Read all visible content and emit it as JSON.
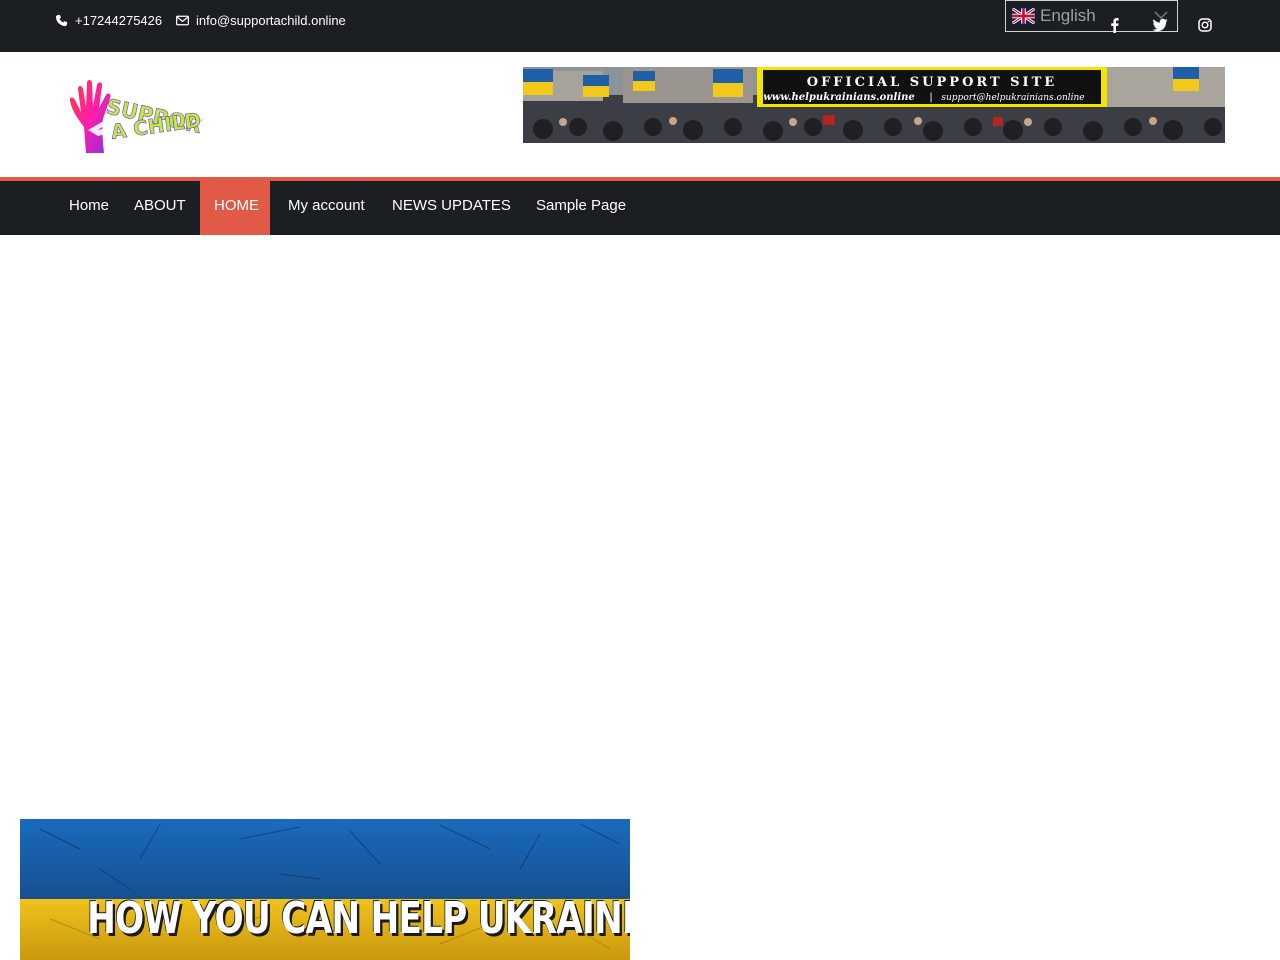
{
  "topbar": {
    "phone": "+17244275426",
    "email": "info@supportachild.online",
    "language": {
      "selected": "English",
      "flag_icon": "uk-flag-icon"
    },
    "social": [
      "facebook-icon",
      "twitter-icon",
      "instagram-icon"
    ]
  },
  "logo": {
    "line1": "SUPPORT",
    "line2": "A CHILD"
  },
  "banner": {
    "title": "OFFICIAL SUPPORT SITE",
    "website": "www.helpukrainians.online",
    "separator": "|",
    "email": "support@helpukrainians.online"
  },
  "nav": {
    "items": [
      {
        "label": "Home",
        "active": false
      },
      {
        "label": "ABOUT",
        "active": false
      },
      {
        "label": "HOME",
        "active": true
      },
      {
        "label": "My account",
        "active": false
      },
      {
        "label": "NEWS UPDATES",
        "active": false
      },
      {
        "label": "Sample Page",
        "active": false
      }
    ]
  },
  "promo": {
    "headline": "HOW YOU CAN HELP UKRAINE"
  },
  "colors": {
    "topbar_bg": "#1b1e22",
    "accent": "#e05a47",
    "ukraine_blue": "#1f5fa8",
    "ukraine_yellow": "#f2c81a"
  }
}
